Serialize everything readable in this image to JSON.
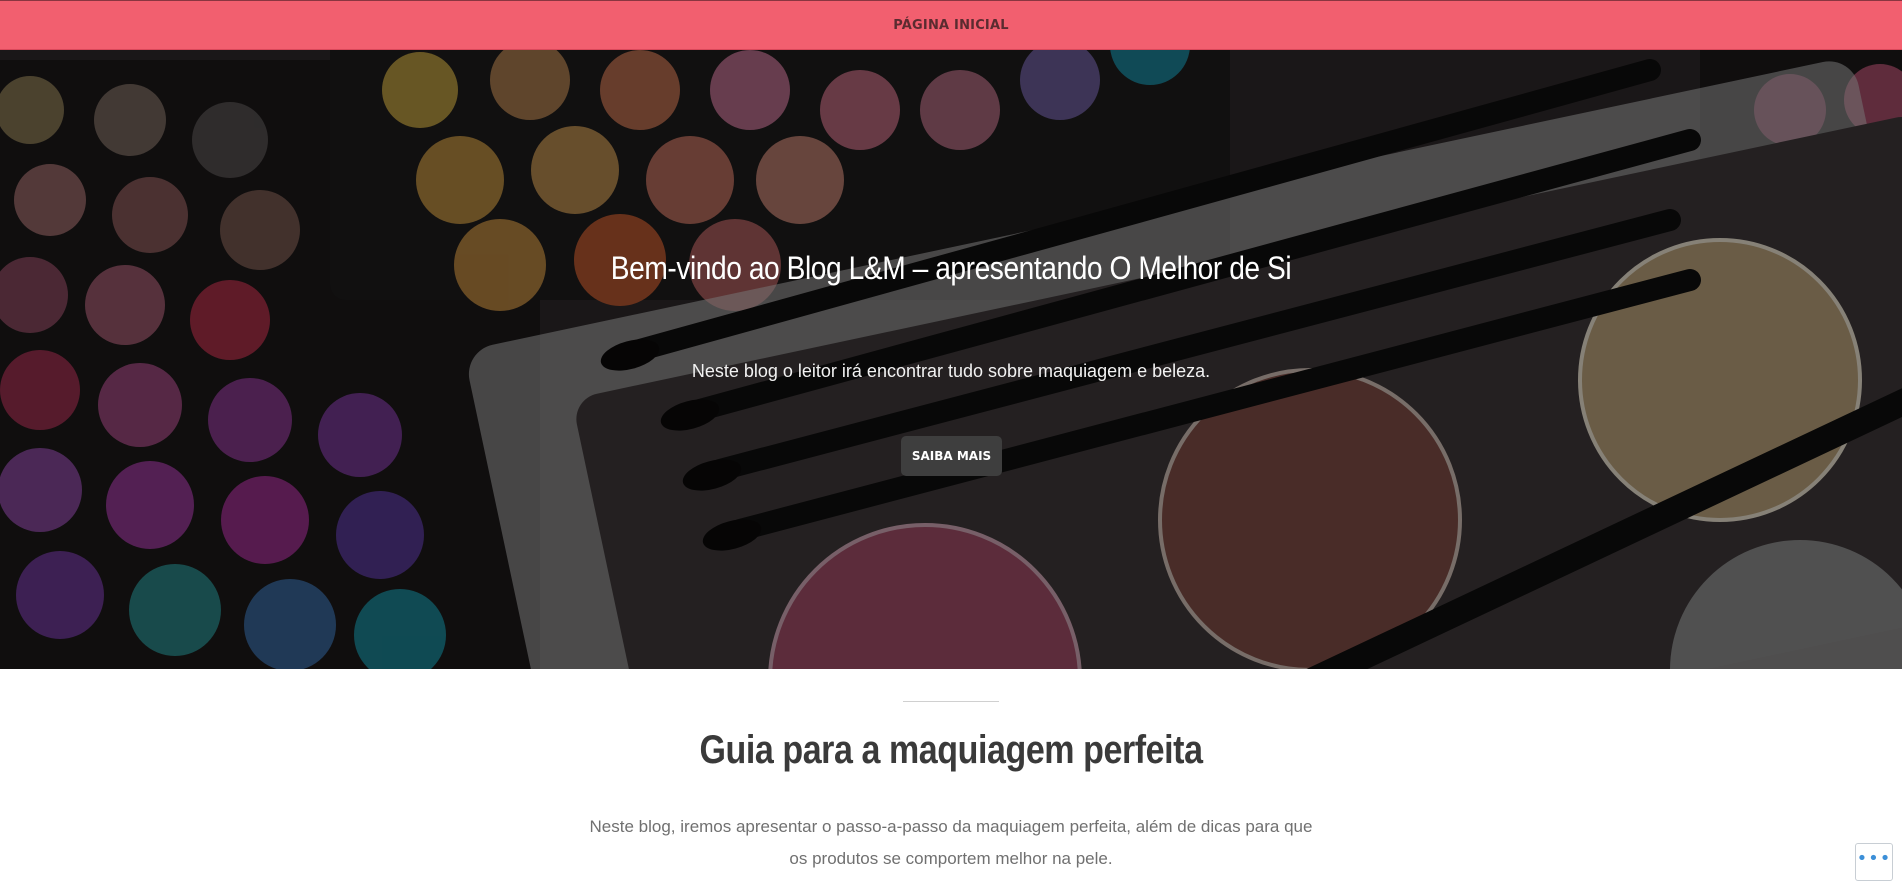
{
  "nav": {
    "home_label": "PÁGINA INICIAL"
  },
  "hero": {
    "title": "Bem-vindo ao Blog L&M – apresentando O Melhor de Si",
    "subtitle": "Neste blog o leitor irá encontrar tudo sobre maquiagem e beleza.",
    "button_label": "SAIBA MAIS"
  },
  "section": {
    "title": "Guia para a maquiagem perfeita",
    "text": "Neste blog, iremos apresentar o passo-a-passo da maquiagem perfeita, além de dicas para que os produtos se comportem melhor na pele."
  },
  "actions": {
    "more_icon": "ellipsis-icon",
    "more_glyph": "•••"
  },
  "colors": {
    "nav_bg": "#f25f6f",
    "hero_button_bg": "#3e3e3e",
    "heading": "#3a3a3a",
    "body_text": "#707070",
    "more_icon": "#3c8fd8"
  }
}
